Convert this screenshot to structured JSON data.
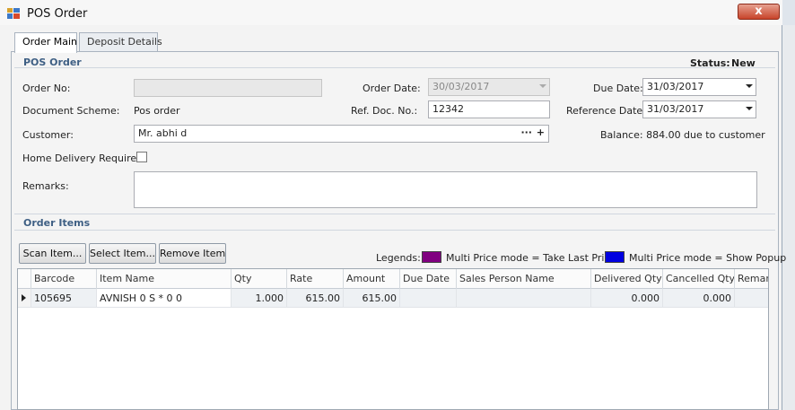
{
  "window": {
    "title": "POS Order",
    "close_label": "x"
  },
  "tabs": [
    {
      "label": "Order Main",
      "active": true
    },
    {
      "label": "Deposit Details",
      "active": false
    }
  ],
  "header": {
    "section_title": "POS Order",
    "status_label": "Status:",
    "status_value": "New"
  },
  "form": {
    "order_no": {
      "label": "Order No:",
      "value": ""
    },
    "order_date": {
      "label": "Order Date:",
      "value": "30/03/2017"
    },
    "due_date": {
      "label": "Due Date:",
      "value": "31/03/2017"
    },
    "document_scheme": {
      "label": "Document Scheme:",
      "value": "Pos order"
    },
    "ref_doc_no": {
      "label": "Ref. Doc. No.:",
      "value": "12342"
    },
    "reference_date": {
      "label": "Reference Date:",
      "value": "31/03/2017"
    },
    "customer": {
      "label": "Customer:",
      "value": "Mr. abhi d",
      "ellipsis": "···",
      "add": "+"
    },
    "balance": "Balance: 884.00 due to customer",
    "home_delivery": {
      "label": "Home Delivery Required:",
      "checked": false
    },
    "remarks": {
      "label": "Remarks:",
      "value": ""
    }
  },
  "order_items": {
    "section_title": "Order Items",
    "buttons": {
      "scan": "Scan Item...",
      "select": "Select Item...",
      "remove": "Remove Item"
    },
    "legends_label": "Legends:",
    "legends": [
      {
        "color": "#800080",
        "text": "Multi Price mode = Take Last Price"
      },
      {
        "color": "#0000e0",
        "text": "Multi Price mode = Show Popup"
      }
    ],
    "columns": [
      "Barcode",
      "Item Name",
      "Qty",
      "Rate",
      "Amount",
      "Due Date",
      "Sales Person Name",
      "Delivered Qty",
      "Cancelled Qty",
      "Remar"
    ],
    "rows": [
      [
        "105695",
        "AVNISH 0 S * 0 0",
        "1.000",
        "615.00",
        "615.00",
        "",
        "",
        "0.000",
        "0.000",
        ""
      ]
    ]
  },
  "colors": {
    "accent": "#3e5f84",
    "close": "#c8442a"
  }
}
